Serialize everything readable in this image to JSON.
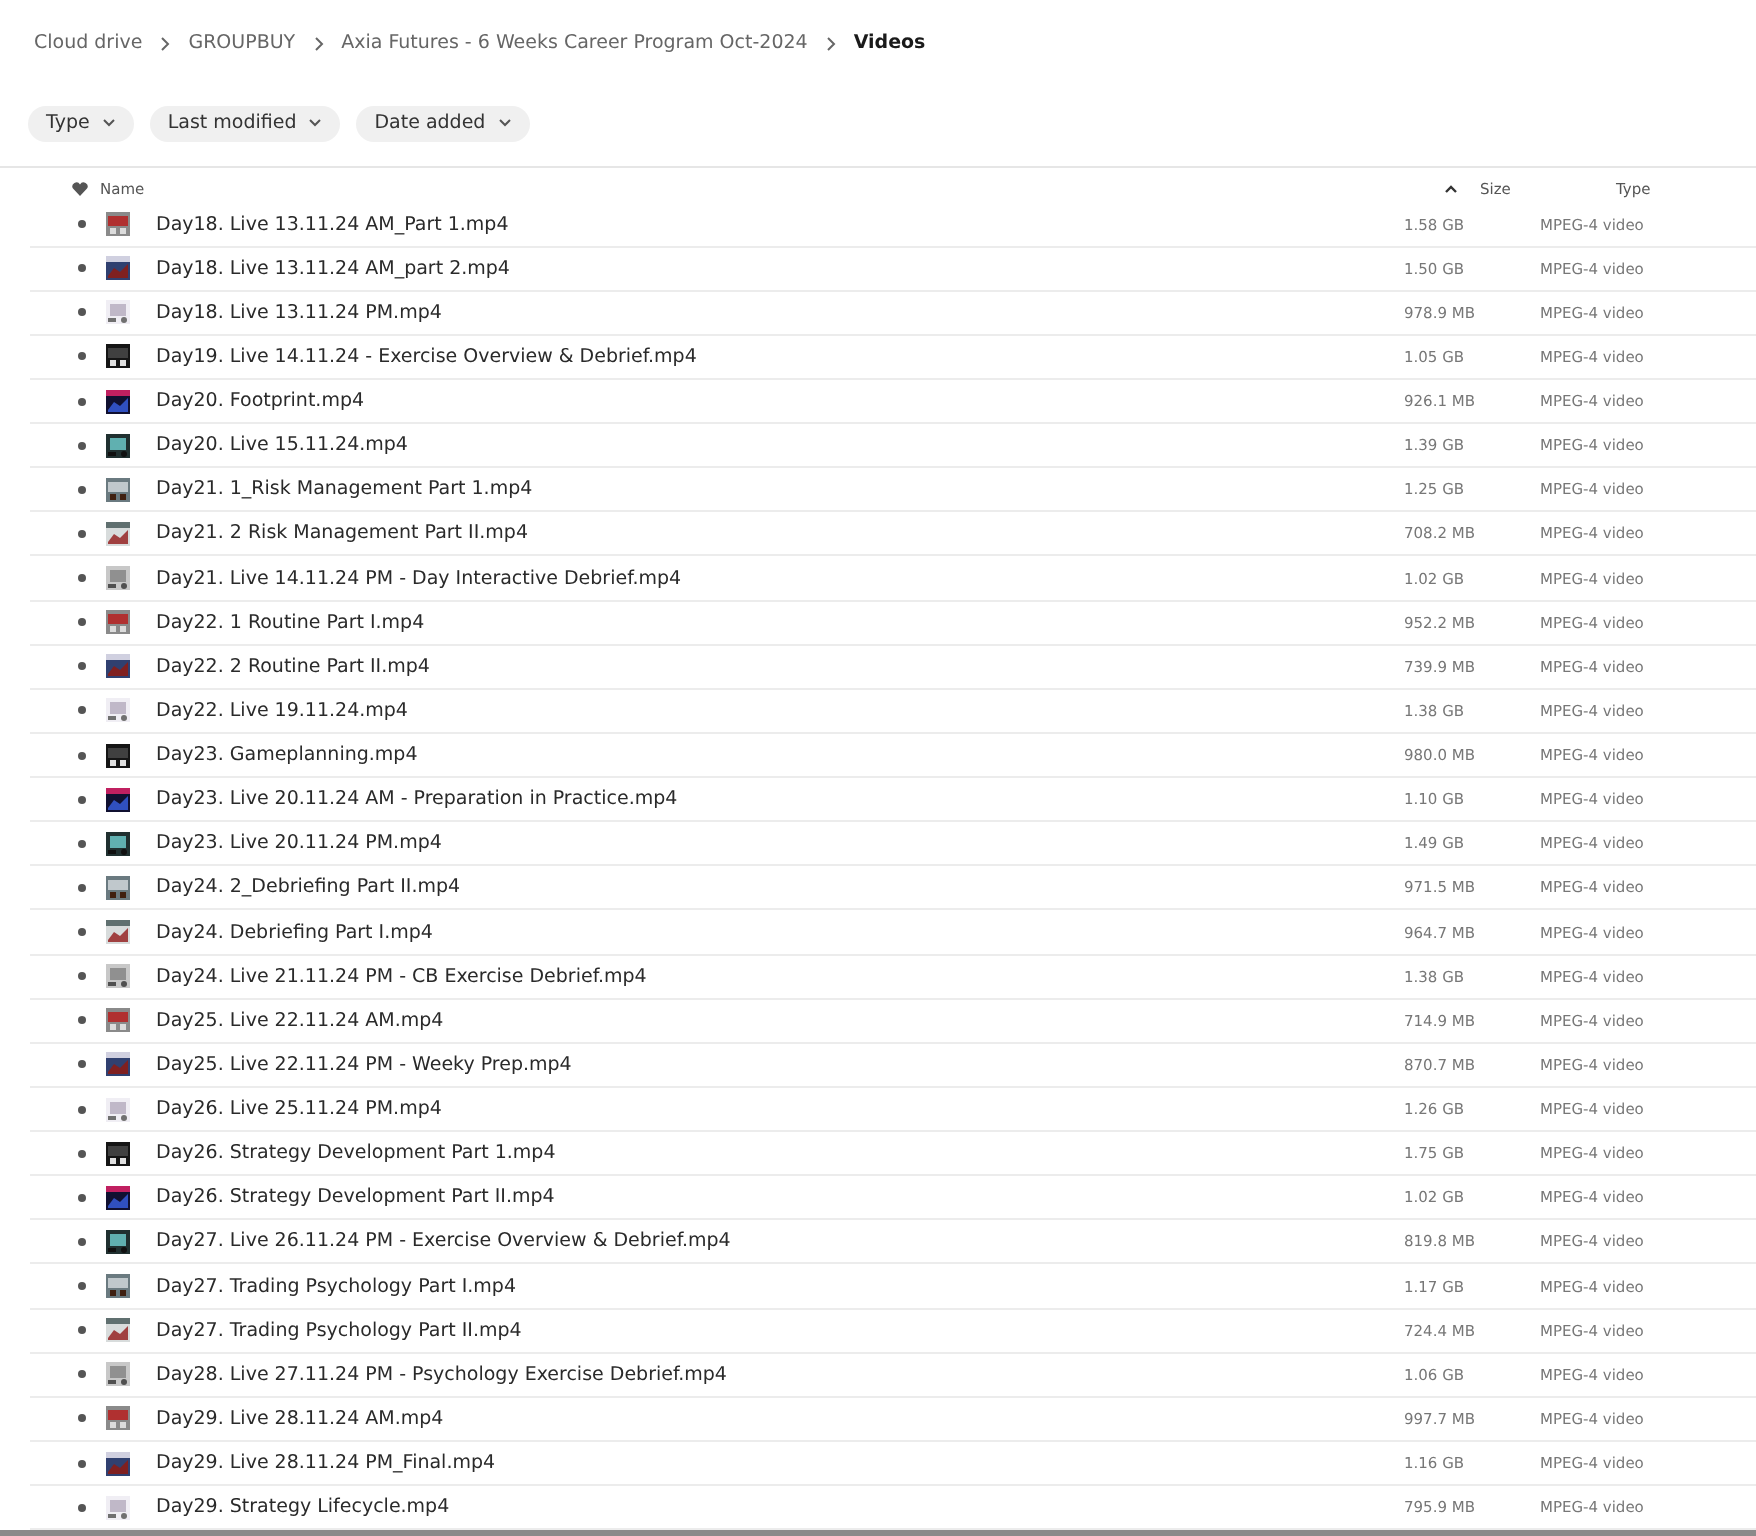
{
  "breadcrumb": [
    "Cloud drive",
    "GROUPBUY",
    "Axia Futures - 6 Weeks Career Program Oct-2024",
    "Videos"
  ],
  "filters": [
    "Type",
    "Last modified",
    "Date added"
  ],
  "table": {
    "columns": [
      "Name",
      "Size",
      "Type"
    ],
    "rows": [
      {
        "name": "Day18. Live 13.11.24 AM_Part 1.mp4",
        "size": "1.58 GB",
        "type": "MPEG-4 video"
      },
      {
        "name": "Day18. Live 13.11.24 AM_part 2.mp4",
        "size": "1.50 GB",
        "type": "MPEG-4 video"
      },
      {
        "name": "Day18. Live 13.11.24 PM.mp4",
        "size": "978.9 MB",
        "type": "MPEG-4 video"
      },
      {
        "name": "Day19. Live 14.11.24 - Exercise Overview & Debrief.mp4",
        "size": "1.05 GB",
        "type": "MPEG-4 video"
      },
      {
        "name": "Day20. Footprint.mp4",
        "size": "926.1 MB",
        "type": "MPEG-4 video"
      },
      {
        "name": "Day20. Live 15.11.24.mp4",
        "size": "1.39 GB",
        "type": "MPEG-4 video"
      },
      {
        "name": "Day21. 1_Risk Management Part 1.mp4",
        "size": "1.25 GB",
        "type": "MPEG-4 video"
      },
      {
        "name": "Day21. 2 Risk Management Part II.mp4",
        "size": "708.2 MB",
        "type": "MPEG-4 video"
      },
      {
        "name": "Day21. Live 14.11.24 PM - Day Interactive Debrief.mp4",
        "size": "1.02 GB",
        "type": "MPEG-4 video"
      },
      {
        "name": "Day22. 1 Routine Part I.mp4",
        "size": "952.2 MB",
        "type": "MPEG-4 video"
      },
      {
        "name": "Day22. 2 Routine Part II.mp4",
        "size": "739.9 MB",
        "type": "MPEG-4 video"
      },
      {
        "name": "Day22. Live 19.11.24.mp4",
        "size": "1.38 GB",
        "type": "MPEG-4 video"
      },
      {
        "name": "Day23. Gameplanning.mp4",
        "size": "980.0 MB",
        "type": "MPEG-4 video"
      },
      {
        "name": "Day23. Live 20.11.24 AM - Preparation in Practice.mp4",
        "size": "1.10 GB",
        "type": "MPEG-4 video"
      },
      {
        "name": "Day23. Live 20.11.24 PM.mp4",
        "size": "1.49 GB",
        "type": "MPEG-4 video"
      },
      {
        "name": "Day24. 2_Debriefing Part II.mp4",
        "size": "971.5 MB",
        "type": "MPEG-4 video"
      },
      {
        "name": "Day24. Debriefing Part I.mp4",
        "size": "964.7 MB",
        "type": "MPEG-4 video"
      },
      {
        "name": "Day24. Live 21.11.24 PM - CB Exercise Debrief.mp4",
        "size": "1.38 GB",
        "type": "MPEG-4 video"
      },
      {
        "name": "Day25. Live 22.11.24 AM.mp4",
        "size": "714.9 MB",
        "type": "MPEG-4 video"
      },
      {
        "name": "Day25. Live 22.11.24 PM - Weeky Prep.mp4",
        "size": "870.7 MB",
        "type": "MPEG-4 video"
      },
      {
        "name": "Day26. Live 25.11.24 PM.mp4",
        "size": "1.26 GB",
        "type": "MPEG-4 video"
      },
      {
        "name": "Day26. Strategy Development Part 1.mp4",
        "size": "1.75 GB",
        "type": "MPEG-4 video"
      },
      {
        "name": "Day26. Strategy Development Part II.mp4",
        "size": "1.02 GB",
        "type": "MPEG-4 video"
      },
      {
        "name": "Day27. Live 26.11.24 PM - Exercise Overview & Debrief.mp4",
        "size": "819.8 MB",
        "type": "MPEG-4 video"
      },
      {
        "name": "Day27. Trading Psychology Part I.mp4",
        "size": "1.17 GB",
        "type": "MPEG-4 video"
      },
      {
        "name": "Day27. Trading Psychology Part II.mp4",
        "size": "724.4 MB",
        "type": "MPEG-4 video"
      },
      {
        "name": "Day28. Live 27.11.24 PM - Psychology Exercise Debrief.mp4",
        "size": "1.06 GB",
        "type": "MPEG-4 video"
      },
      {
        "name": "Day29. Live 28.11.24 AM.mp4",
        "size": "997.7 MB",
        "type": "MPEG-4 video"
      },
      {
        "name": "Day29. Live 28.11.24 PM_Final.mp4",
        "size": "1.16 GB",
        "type": "MPEG-4 video"
      },
      {
        "name": "Day29. Strategy Lifecycle.mp4",
        "size": "795.9 MB",
        "type": "MPEG-4 video"
      }
    ]
  }
}
